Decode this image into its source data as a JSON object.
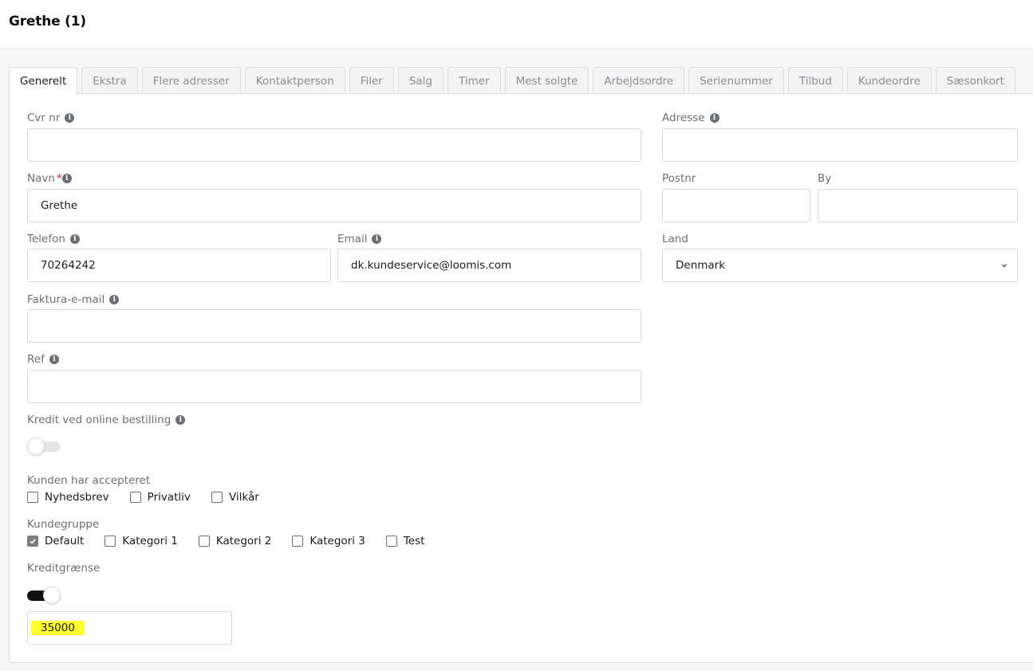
{
  "header": {
    "title": "Grethe (1)"
  },
  "tabs": [
    {
      "label": "Generelt"
    },
    {
      "label": "Ekstra"
    },
    {
      "label": "Flere adresser"
    },
    {
      "label": "Kontaktperson"
    },
    {
      "label": "Filer"
    },
    {
      "label": "Salg"
    },
    {
      "label": "Timer"
    },
    {
      "label": "Mest solgte"
    },
    {
      "label": "Arbejdsordre"
    },
    {
      "label": "Serienummer"
    },
    {
      "label": "Tilbud"
    },
    {
      "label": "Kundeordre"
    },
    {
      "label": "Sæsonkort"
    }
  ],
  "form": {
    "cvr": {
      "label": "Cvr nr",
      "value": ""
    },
    "navn": {
      "label": "Navn",
      "required_mark": "*",
      "value": "Grethe"
    },
    "telefon": {
      "label": "Telefon",
      "value": "70264242"
    },
    "email": {
      "label": "Email",
      "value": "dk.kundeservice@loomis.com"
    },
    "faktura_email": {
      "label": "Faktura-e-mail",
      "value": ""
    },
    "ref": {
      "label": "Ref",
      "value": ""
    },
    "kredit_online": {
      "label": "Kredit ved online bestilling",
      "enabled": false
    },
    "accepteret": {
      "label": "Kunden har accepteret",
      "options": [
        {
          "label": "Nyhedsbrev",
          "checked": false
        },
        {
          "label": "Privatliv",
          "checked": false
        },
        {
          "label": "Vilkår",
          "checked": false
        }
      ]
    },
    "kundegruppe": {
      "label": "Kundegruppe",
      "options": [
        {
          "label": "Default",
          "checked": true
        },
        {
          "label": "Kategori 1",
          "checked": false
        },
        {
          "label": "Kategori 2",
          "checked": false
        },
        {
          "label": "Kategori 3",
          "checked": false
        },
        {
          "label": "Test",
          "checked": false
        }
      ]
    },
    "kreditgraense": {
      "label": "Kreditgrænse",
      "enabled": true,
      "value": "35000"
    },
    "adresse": {
      "label": "Adresse",
      "value": ""
    },
    "postnr": {
      "label": "Postnr",
      "value": ""
    },
    "by": {
      "label": "By",
      "value": ""
    },
    "land": {
      "label": "Land",
      "value": "Denmark"
    }
  },
  "icons": {
    "info": "info-icon",
    "dropdown": "chevron-down-icon",
    "check": "check-icon"
  },
  "colors": {
    "highlight": "#ffff2e",
    "required": "#d3202e",
    "toggle_on": "#111111"
  }
}
